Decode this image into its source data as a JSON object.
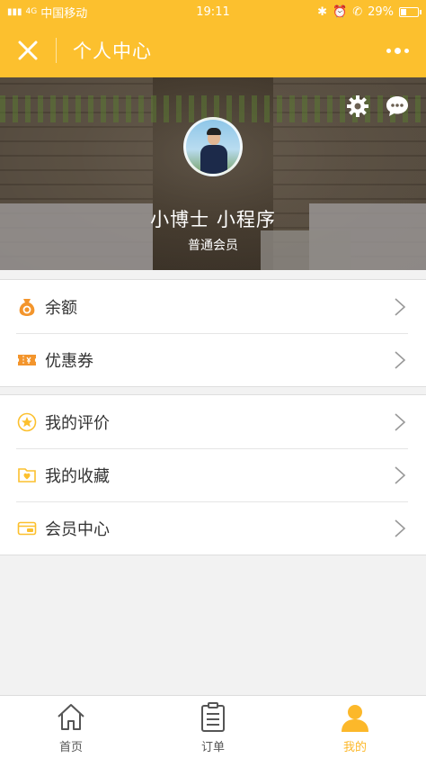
{
  "status_bar": {
    "carrier": "中国移动",
    "signal_text": "4G",
    "time": "19:11",
    "battery": "29%",
    "battery_level": 0.29
  },
  "navbar": {
    "title": "个人中心",
    "close_icon": "close-icon",
    "more_icon": "more-dots-icon"
  },
  "profile": {
    "name": "小博士 小程序",
    "level": "普通会员"
  },
  "menu": {
    "group1": [
      {
        "label": "余额",
        "icon": "money-bag-icon"
      },
      {
        "label": "优惠券",
        "icon": "coupon-icon"
      }
    ],
    "group2": [
      {
        "label": "我的评价",
        "icon": "star-icon"
      },
      {
        "label": "我的收藏",
        "icon": "heart-folder-icon"
      },
      {
        "label": "会员中心",
        "icon": "vip-card-icon"
      }
    ]
  },
  "tabs": [
    {
      "label": "首页",
      "icon": "home-icon"
    },
    {
      "label": "订单",
      "icon": "clipboard-icon"
    },
    {
      "label": "我的",
      "icon": "user-icon",
      "active": true
    }
  ],
  "colors": {
    "brand": "#fcc02e",
    "icon_orange": "#f3952c",
    "active_tab": "#fcb82a"
  }
}
